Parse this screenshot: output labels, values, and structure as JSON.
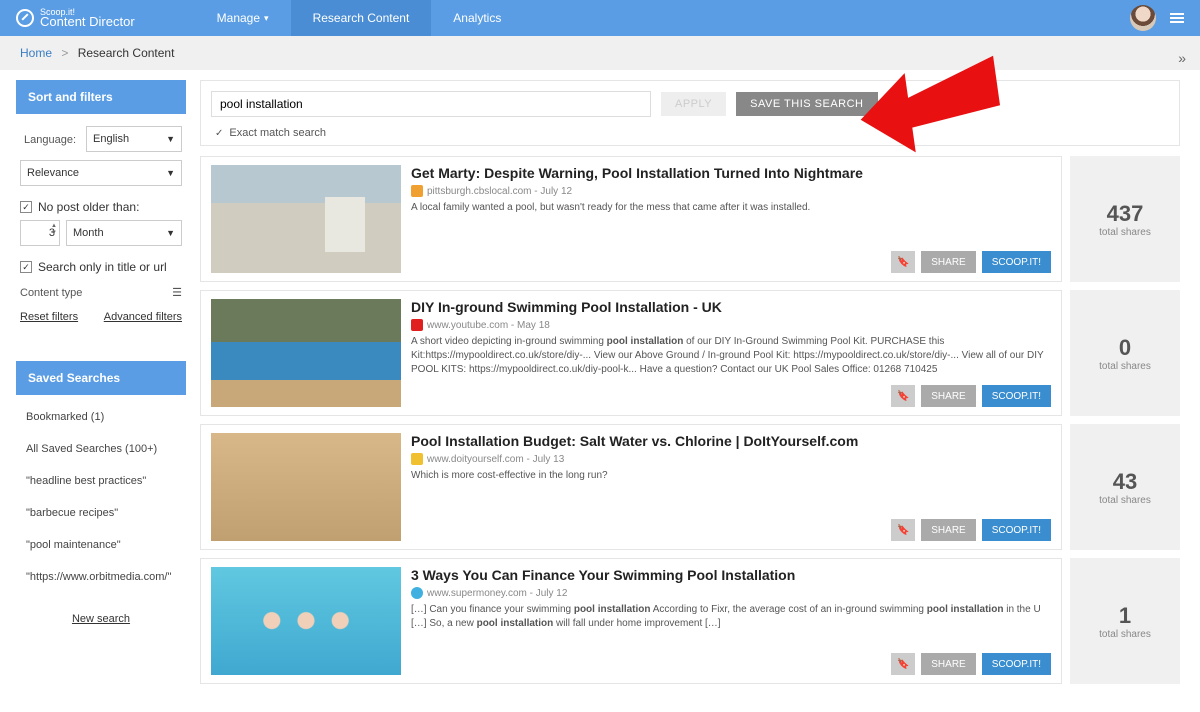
{
  "brand": {
    "small": "Scoop.it!",
    "name": "Content Director"
  },
  "nav": {
    "manage": "Manage",
    "research": "Research Content",
    "analytics": "Analytics"
  },
  "breadcrumb": {
    "home": "Home",
    "current": "Research Content"
  },
  "filters": {
    "header": "Sort and filters",
    "language_label": "Language:",
    "language_value": "English",
    "sort_value": "Relevance",
    "no_older_label": "No post older than:",
    "age_value": "3",
    "age_unit": "Month",
    "search_title_label": "Search only in title or url",
    "content_type_label": "Content type",
    "reset_link": "Reset filters",
    "advanced_link": "Advanced filters"
  },
  "saved": {
    "header": "Saved Searches",
    "items": [
      "Bookmarked (1)",
      "All Saved Searches (100+)",
      "\"headline best practices\"",
      "\"barbecue recipes\"",
      "\"pool maintenance\"",
      "\"https://www.orbitmedia.com/\""
    ],
    "new_search": "New search"
  },
  "search": {
    "value": "pool installation",
    "apply": "APPLY",
    "save": "SAVE THIS SEARCH",
    "exact_label": "Exact match search"
  },
  "actions": {
    "share": "SHARE",
    "scoop": "SCOOP.IT!"
  },
  "shares_label": "total shares",
  "results": [
    {
      "title_pre": "Get Marty: Despite Warning, ",
      "title_bold": "Pool Installation",
      "title_post": " Turned Into Nightmare",
      "source": "pittsburgh.cbslocal.com",
      "date": "July 12",
      "src_class": "src-cbs",
      "desc_pre": "A local family wanted a pool, but wasn't ready for the mess that came after it was installed.",
      "desc_bold": "",
      "desc_post": "",
      "shares": "437",
      "thumb": "thumb1"
    },
    {
      "title_pre": "DIY In-ground Swimming ",
      "title_bold": "Pool Installation",
      "title_post": " - UK",
      "source": "www.youtube.com",
      "date": "May 18",
      "src_class": "src-yt",
      "desc_pre": "A short video depicting in-ground swimming ",
      "desc_bold": "pool installation",
      "desc_post": " of our DIY In-Ground Swimming Pool Kit. PURCHASE this Kit:https://mypooldirect.co.uk/store/diy-... View our Above Ground / In-ground Pool Kit: https://mypooldirect.co.uk/store/diy-... View all of our DIY POOL KITS: https://mypooldirect.co.uk/diy-pool-k... Have a question? Contact our UK Pool Sales Office: 01268 710425",
      "shares": "0",
      "thumb": "thumb2"
    },
    {
      "title_pre": "",
      "title_bold": "Pool Installation",
      "title_post": " Budget: Salt Water vs. Chlorine | DoItYourself.com",
      "source": "www.doityourself.com",
      "date": "July 13",
      "src_class": "src-diy",
      "desc_pre": "Which is more cost-effective in the long run?",
      "desc_bold": "",
      "desc_post": "",
      "shares": "43",
      "thumb": "thumb3"
    },
    {
      "title_pre": "3 Ways You Can Finance Your Swimming ",
      "title_bold": "Pool Installation",
      "title_post": "",
      "source": "www.supermoney.com",
      "date": "July 12",
      "src_class": "src-sm",
      "desc_pre": "[…] Can you finance your swimming ",
      "desc_bold": "pool installation",
      "desc_post": " According to Fixr, the average cost of an in-ground swimming ",
      "desc_bold2": "pool installation",
      "desc_post2": " in the U […] So, a new ",
      "desc_bold3": "pool installation",
      "desc_post3": " will fall under home improvement […]",
      "shares": "1",
      "thumb": "thumb4"
    }
  ]
}
